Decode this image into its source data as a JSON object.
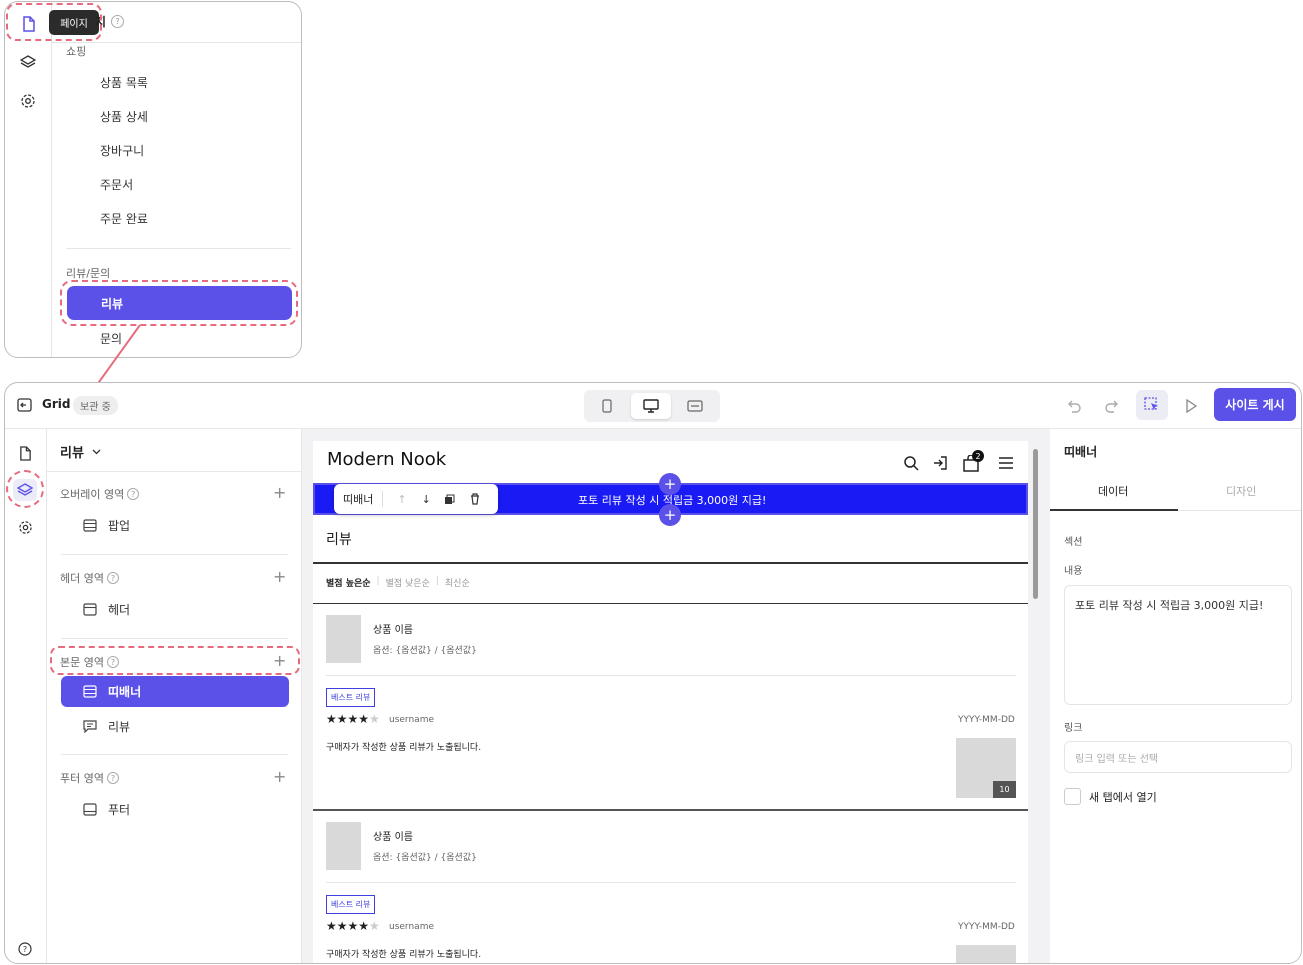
{
  "popup": {
    "tooltip": "페이지",
    "title_hidden": "지",
    "section_shopping": "쇼핑",
    "shopping_items": [
      "상품 목록",
      "상품 상세",
      "장바구니",
      "주문서",
      "주문 완료"
    ],
    "section_review": "리뷰/문의",
    "active_item": "리뷰",
    "next_item": "문의"
  },
  "topbar": {
    "app_name": "Grid",
    "status_badge": "보관 중",
    "publish_label": "사이트 게시"
  },
  "left_panel": {
    "page_selector": "리뷰",
    "areas": [
      {
        "label": "오버레이 영역",
        "layers": [
          "팝업"
        ]
      },
      {
        "label": "헤더 영역",
        "layers": [
          "헤더"
        ]
      },
      {
        "label": "본문 영역",
        "layers": [
          "띠배너",
          "리뷰"
        ]
      },
      {
        "label": "푸터 영역",
        "layers": [
          "푸터"
        ]
      }
    ]
  },
  "preview": {
    "brand": "Modern Nook",
    "cart_count": "2",
    "banner_text": "포토 리뷰 작성 시 적립금 3,000원 지급!",
    "toolbar_label": "띠배너",
    "page_title": "리뷰",
    "sort_options": [
      "별점 높은순",
      "별점 낮은순",
      "최신순"
    ],
    "reviews": [
      {
        "product_name": "상품 이름",
        "options": "옵션: {옵션값} / {옵션값}",
        "tag": "베스트 리뷰",
        "stars": "★★★★",
        "star_empty": "★",
        "username": "username",
        "date": "YYYY-MM-DD",
        "body": "구매자가 작성한 상품 리뷰가 노출됩니다.",
        "photo_count": "10"
      },
      {
        "product_name": "상품 이름",
        "options": "옵션: {옵션값} / {옵션값}",
        "tag": "베스트 리뷰",
        "stars": "★★★★",
        "star_empty": "★",
        "username": "username",
        "date": "YYYY-MM-DD",
        "body": "구매자가 작성한 상품 리뷰가 노출됩니다."
      }
    ]
  },
  "right_panel": {
    "title": "띠배너",
    "tabs": [
      "데이터",
      "디자인"
    ],
    "section_label": "섹션",
    "content_label": "내용",
    "content_value": "포토 리뷰 작성 시 적립금 3,000원 지급!",
    "link_label": "링크",
    "link_placeholder": "링크 입력 또는 선택",
    "new_tab_label": "새 탭에서 열기"
  },
  "colors": {
    "accent": "#5b51e8",
    "banner_blue": "#1a1af5",
    "highlight_dash": "#e56c7e"
  }
}
